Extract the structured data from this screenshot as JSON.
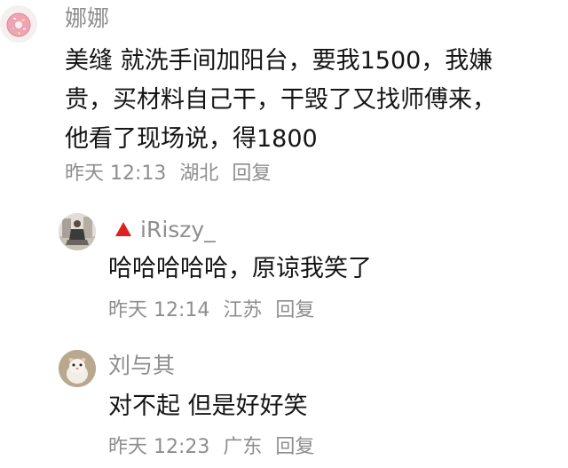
{
  "comments": [
    {
      "username": "娜娜",
      "lines": [
        "美缝 就洗手间加阳台，要我1500，我嫌",
        "贵，买材料自己干，干毁了又找师傅来，",
        "他看了现场说，得1800"
      ],
      "time": "昨天 12:13",
      "location": "湖北",
      "reply_label": "回复"
    }
  ],
  "replies": [
    {
      "username": "iRiszy_",
      "badge_icon": "red-triangle-icon",
      "text": "哈哈哈哈哈，原谅我笑了",
      "time": "昨天 12:14",
      "location": "江苏",
      "reply_label": "回复"
    },
    {
      "username": "刘与其",
      "text": "对不起 但是好好笑",
      "time": "昨天 12:23",
      "location": "广东",
      "reply_label": "回复"
    }
  ],
  "colors": {
    "meta_text": "#8e8e8e",
    "body_text": "#151515",
    "badge": "#e02020",
    "donut_pink": "#f3a6b6"
  }
}
